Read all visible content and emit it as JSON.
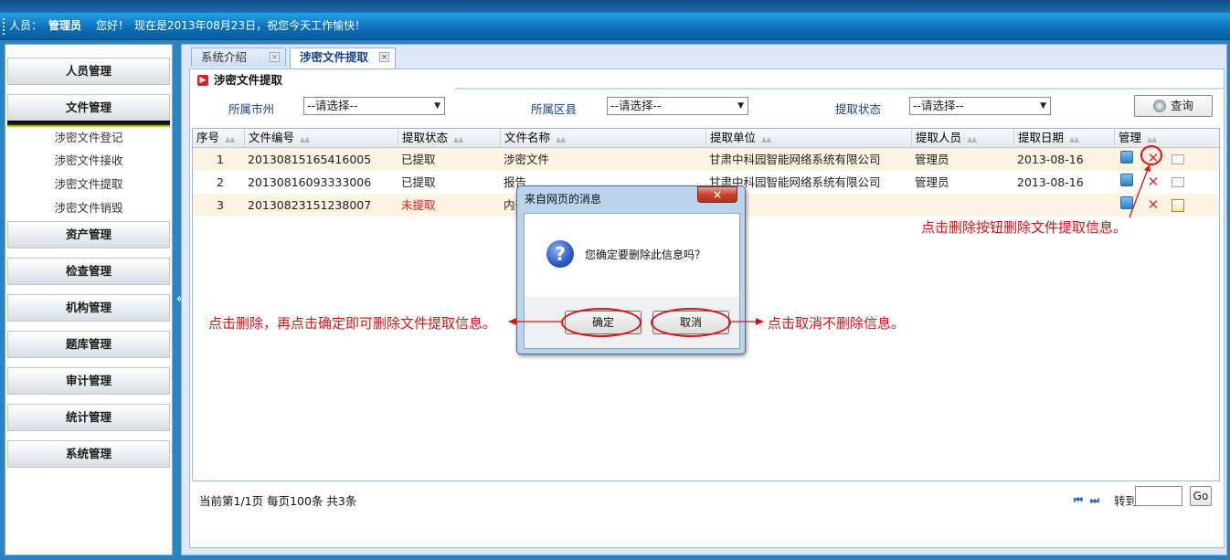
{
  "header": {
    "person_label": "人员：",
    "user_name": "管理员",
    "greeting": "您好！",
    "date_message": "现在是2013年08月23日，祝您今天工作愉快！"
  },
  "sidebar": {
    "menus": [
      {
        "label": "人员管理"
      },
      {
        "label": "文件管理"
      },
      {
        "label": "资产管理"
      },
      {
        "label": "检查管理"
      },
      {
        "label": "机构管理"
      },
      {
        "label": "题库管理"
      },
      {
        "label": "审计管理"
      },
      {
        "label": "统计管理"
      },
      {
        "label": "系统管理"
      }
    ],
    "submenu": [
      {
        "label": "涉密文件登记"
      },
      {
        "label": "涉密文件接收"
      },
      {
        "label": "涉密文件提取"
      },
      {
        "label": "涉密文件销毁"
      }
    ],
    "collapse_glyph": "«"
  },
  "tabs": [
    {
      "label": "系统介绍",
      "close": "×"
    },
    {
      "label": "涉密文件提取",
      "close": "×",
      "active": true
    }
  ],
  "panel": {
    "title": "涉密文件提取",
    "filters": {
      "city_label": "所属市州",
      "city_value": "--请选择--",
      "district_label": "所属区县",
      "district_value": "--请选择--",
      "status_label": "提取状态",
      "status_value": "--请选择--"
    },
    "query_button": "查询"
  },
  "grid": {
    "columns": [
      "序号",
      "文件编号",
      "提取状态",
      "文件名称",
      "提取单位",
      "提取人员",
      "提取日期",
      "管理"
    ],
    "sort_glyph": "▲▲",
    "rows": [
      {
        "index": "1",
        "file_no": "20130815165416005",
        "status": "已提取",
        "name": "涉密文件",
        "unit": "甘肃中科园智能网络系统有限公司",
        "person": "管理员",
        "date": "2013-08-16"
      },
      {
        "index": "2",
        "file_no": "20130816093333006",
        "status": "已提取",
        "name": "报告",
        "unit": "甘肃中科园智能网络系统有限公司",
        "person": "管理员",
        "date": "2013-08-16"
      },
      {
        "index": "3",
        "file_no": "20130823151238007",
        "status": "未提取",
        "name": "内部",
        "unit": "",
        "person": "",
        "date": ""
      }
    ]
  },
  "pager": {
    "summary": "当前第1/1页  每页100条  共3条",
    "first": "⏮",
    "last": "⏭",
    "goto_label": "转到",
    "go_button": "Go"
  },
  "dialog": {
    "title": "来自网页的消息",
    "close": "×",
    "message": "您确定要删除此信息吗？",
    "icon_glyph": "?",
    "ok_button": "确定",
    "cancel_button": "取消"
  },
  "annotations": {
    "delete_hint": "点击删除按钮删除文件提取信息。",
    "confirm_hint": "点击删除，再点击确定即可删除文件提取信息。",
    "cancel_hint": "点击取消不删除信息。"
  },
  "colors": {
    "accent_blue": "#1e6ea8",
    "annotation_red": "#e01010",
    "not_extracted_red": "#e21a1a"
  }
}
